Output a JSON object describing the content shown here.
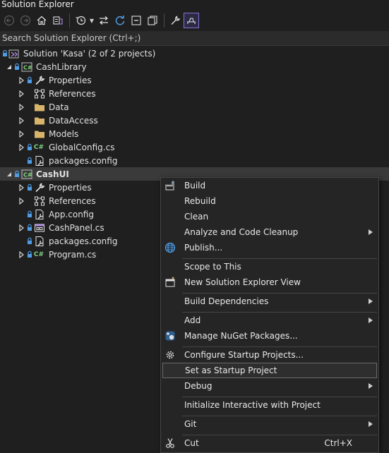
{
  "window": {
    "title": "Solution Explorer"
  },
  "toolbar": {
    "buttons": [
      {
        "icon": "back-arrow-icon"
      },
      {
        "icon": "forward-arrow-icon"
      },
      {
        "icon": "home-icon"
      },
      {
        "icon": "switch-views-icon"
      },
      {
        "icon": "pending-changes-filter-icon"
      },
      {
        "icon": "sync-with-active-document-icon"
      },
      {
        "icon": "refresh-icon"
      },
      {
        "icon": "collapse-all-icon"
      },
      {
        "icon": "show-all-files-icon"
      },
      {
        "icon": "properties-wrench-icon"
      },
      {
        "icon": "preview-selected-items-icon"
      }
    ]
  },
  "search": {
    "placeholder": "Search Solution Explorer (Ctrl+;)"
  },
  "tree": {
    "solution": "Solution 'Kasa' (2 of 2 projects)",
    "project1": {
      "name": "CashLibrary",
      "items": [
        "Properties",
        "References",
        "Data",
        "DataAccess",
        "Models",
        "GlobalConfig.cs",
        "packages.config"
      ]
    },
    "project2": {
      "name": "CashUI",
      "items": [
        "Properties",
        "References",
        "App.config",
        "CashPanel.cs",
        "packages.config",
        "Program.cs"
      ]
    }
  },
  "context_menu": {
    "build": "Build",
    "rebuild": "Rebuild",
    "clean": "Clean",
    "analyze": "Analyze and Code Cleanup",
    "publish": "Publish...",
    "scope": "Scope to This",
    "new_view": "New Solution Explorer View",
    "build_deps": "Build Dependencies",
    "add": "Add",
    "nuget": "Manage NuGet Packages...",
    "configure_startup": "Configure Startup Projects...",
    "set_startup": "Set as Startup Project",
    "debug": "Debug",
    "interactive": "Initialize Interactive with Project",
    "git": "Git",
    "cut": "Cut",
    "cut_shortcut": "Ctrl+X"
  },
  "colors": {
    "background": "#1f1f1f",
    "accent": "#7f74d6",
    "csharp": "#7fd17f",
    "folder": "#d8b56a",
    "lock": "#4e9de6"
  }
}
